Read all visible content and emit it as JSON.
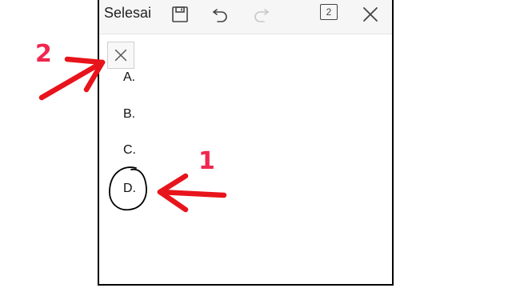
{
  "toolbar": {
    "done_label": "Selesai",
    "page_count": "2"
  },
  "options": [
    {
      "label": "A."
    },
    {
      "label": "B."
    },
    {
      "label": "C."
    },
    {
      "label": "D."
    }
  ],
  "annotations": {
    "step1": "1",
    "step2": "2",
    "arrow_color": "#e8141c",
    "number_color": "#f0274f"
  },
  "icons": [
    "save-icon",
    "undo-icon",
    "redo-icon",
    "close-icon",
    "page-count-icon",
    "close-x-icon"
  ]
}
